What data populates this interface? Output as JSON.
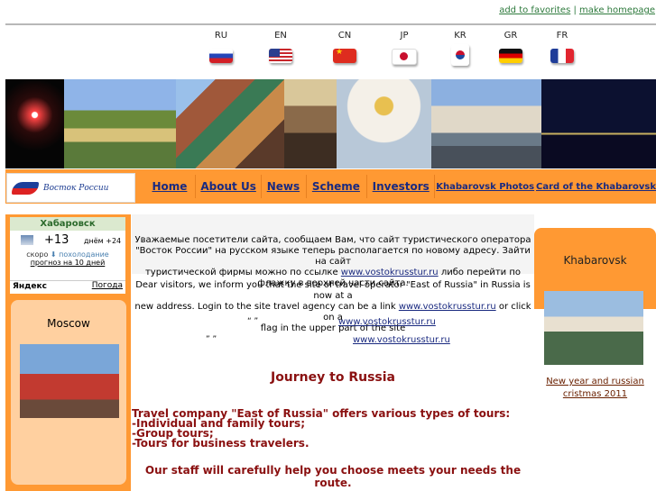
{
  "top_links": {
    "favorites": "add to favorites",
    "separator": "|",
    "homepage": "make homepage"
  },
  "languages": [
    {
      "code": "RU",
      "flag": "russia-flag"
    },
    {
      "code": "EN",
      "flag": "usa-flag"
    },
    {
      "code": "CN",
      "flag": "china-flag"
    },
    {
      "code": "JP",
      "flag": "japan-flag"
    },
    {
      "code": "KR",
      "flag": "korea-flag"
    },
    {
      "code": "GR",
      "flag": "germany-flag"
    },
    {
      "code": "FR",
      "flag": "france-flag"
    }
  ],
  "logo": {
    "text": "Восток России"
  },
  "nav": {
    "home": "Home",
    "about": "About Us",
    "news": "News",
    "scheme": "Scheme",
    "investors": "Investors",
    "photos": "Khabarovsk Photos",
    "card": "Card of the Khabarovsk"
  },
  "weather": {
    "city": "Хабаровск",
    "temp": "+13",
    "day": "днём +24",
    "soon_prefix": "скоро",
    "soon_text": "похолодание",
    "forecast": "прогноз на 10 дней",
    "yandex": "Яндекс",
    "pogoda": "Погода"
  },
  "left": {
    "moscow": "Moscow"
  },
  "right": {
    "khabarovsk": "Khabarovsk",
    "caption1": "New year and russian",
    "caption2": "cristmas 2011"
  },
  "main": {
    "ru_line1": "Уважаемые посетители сайта, сообщаем Вам, что сайт туристического оператора",
    "ru_line2": "\"Восток России\" на русском языке теперь располагается по новому адресу. Зайти на сайт",
    "ru_line3a": "туристической фирмы можно по ссылке",
    "ru_link": "www.vostokrusstur.ru",
    "ru_line3b": "либо перейти по",
    "ru_line4": "флажку в верхней части сайта.",
    "en_line1": "Dear visitors, we inform you that the site of travel operator \"East of Russia\" in Russia is now at a",
    "en_line2": "new address. Login to the site travel agency can be a link",
    "en_link": "www.vostokrusstur.ru",
    "en_line2b": "or click on a",
    "en_line3": "flag in the upper part of the site",
    "q1": "“    ”",
    "q1_link": "www.vostokrusstur.ru",
    "q2": "”    ”",
    "q2_link": "www.vostokrusstur.ru",
    "journey": "Journey to Russia",
    "tours_intro": "Travel company \"East of Russia\" offers various types of tours:",
    "tour1": "-Individual and family tours;",
    "tour2": "-Group tours;",
    "tour3": "-Tours for business travelers.",
    "staff": "Our staff will carefully help you choose meets your needs the route."
  }
}
